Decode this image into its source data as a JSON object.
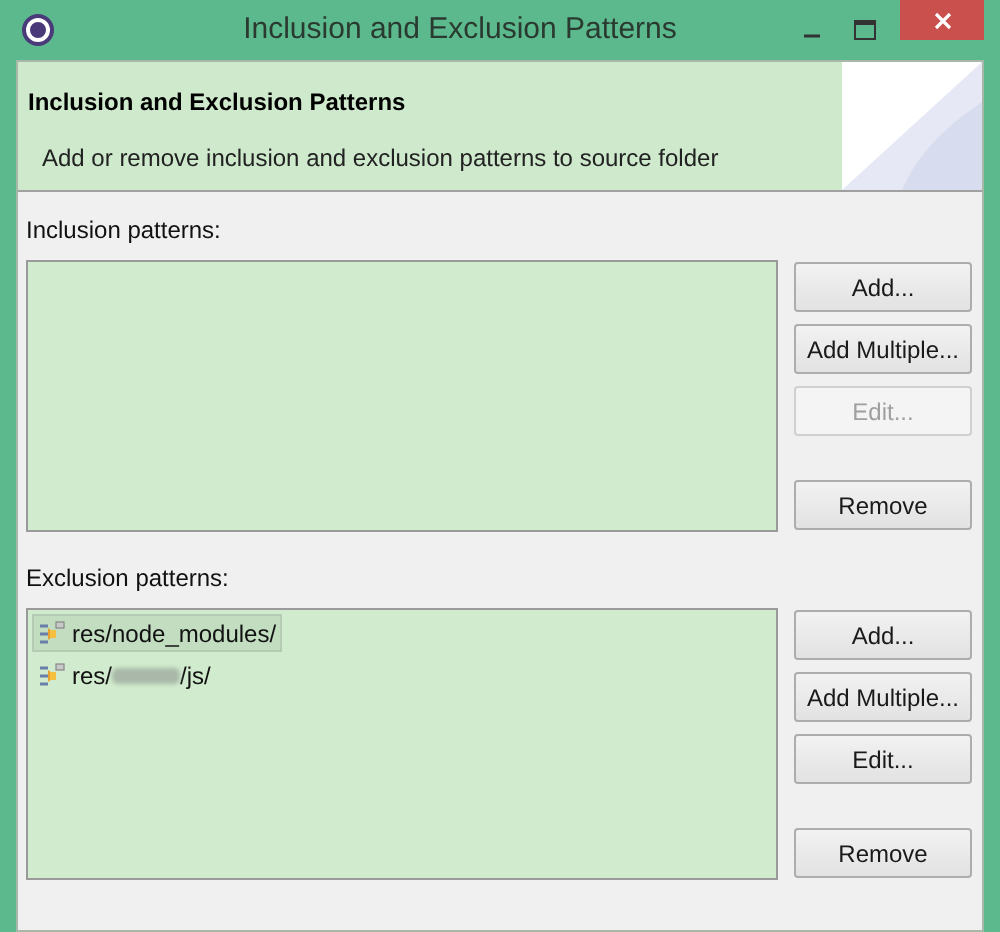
{
  "window": {
    "title": "Inclusion and Exclusion Patterns"
  },
  "header": {
    "title": "Inclusion and Exclusion Patterns",
    "description": "Add or remove inclusion and exclusion patterns to source folder"
  },
  "sections": [
    {
      "label": "Inclusion patterns:",
      "buttons": [
        {
          "label": "Add...",
          "disabled": false
        },
        {
          "label": "Add Multiple...",
          "disabled": false
        },
        {
          "label": "Edit...",
          "disabled": true
        },
        {
          "label": "Remove",
          "disabled": false,
          "kind": "separated"
        }
      ]
    },
    {
      "label": "Exclusion patterns:",
      "items": [
        {
          "prefix": "res/node_modules/",
          "selected": true
        },
        {
          "prefix": "res/",
          "blurred": true,
          "suffix": "/js/",
          "selected": false
        }
      ],
      "buttons": [
        {
          "label": "Add...",
          "disabled": false
        },
        {
          "label": "Add Multiple...",
          "disabled": false
        },
        {
          "label": "Edit...",
          "disabled": false
        },
        {
          "label": "Remove",
          "disabled": false,
          "kind": "separated"
        }
      ]
    }
  ]
}
